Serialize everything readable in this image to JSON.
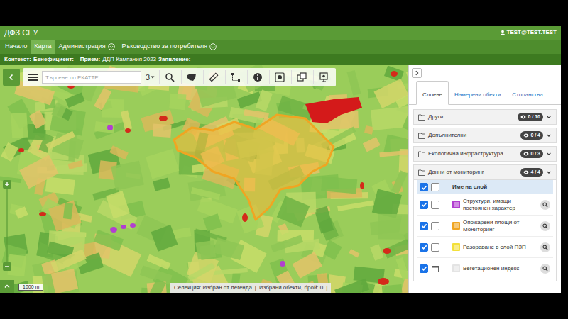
{
  "header": {
    "title": "ДФЗ СЕУ",
    "user": "TEST@TEST.TEST"
  },
  "nav": [
    {
      "label": "Начало",
      "selected": false,
      "dropdown": false
    },
    {
      "label": "Карта",
      "selected": true,
      "dropdown": false
    },
    {
      "label": "Администрация",
      "selected": false,
      "dropdown": true
    },
    {
      "label": "Ръководство за потребителя",
      "selected": false,
      "dropdown": true
    }
  ],
  "context": {
    "label": "Контекст:",
    "items": [
      {
        "label": "Бенефициент:",
        "value": "-"
      },
      {
        "label": "Прием:",
        "value": "ДДП-Кампания 2023"
      },
      {
        "label": "Заявление:",
        "value": "-"
      }
    ]
  },
  "toolbar": {
    "search_placeholder": "Търсене по ЕКАТТЕ",
    "zoom_level": "3"
  },
  "map": {
    "scale": "1000 m",
    "status": [
      {
        "text": "Селекция: Избран от легенда"
      },
      {
        "text": "Избрани обекти, брой: 0"
      }
    ],
    "separator": "|"
  },
  "panel": {
    "tabs": [
      {
        "label": "Слоеве",
        "selected": true
      },
      {
        "label": "Намерени обекти",
        "selected": false
      },
      {
        "label": "Стопанства",
        "selected": false
      }
    ],
    "groups": [
      {
        "label": "Други",
        "badge": "0 / 10",
        "expanded": false
      },
      {
        "label": "Допълнителни",
        "badge": "0 / 4",
        "expanded": false
      },
      {
        "label": "Екологична инфраструктура",
        "badge": "0 / 3",
        "expanded": false
      },
      {
        "label": "Данни от мониторинг",
        "badge": "4 / 4",
        "expanded": true
      }
    ],
    "layers": {
      "header": "Име на слой",
      "all_visible": true,
      "all_selected": false,
      "rows": [
        {
          "name": "Структури, имащи постоянен характер",
          "visible": true,
          "kind": "checkbox",
          "selected": false,
          "color": "#b23fd0"
        },
        {
          "name": "Опожарени площи от Мониторинг",
          "visible": true,
          "kind": "checkbox",
          "selected": false,
          "color": "#f0a522"
        },
        {
          "name": "Разораване в слой ПЗП",
          "visible": true,
          "kind": "checkbox",
          "selected": false,
          "color": "#f3e03a"
        },
        {
          "name": "Вегетационен индекс",
          "visible": true,
          "kind": "calendar",
          "color": "#e4e4e4"
        }
      ]
    }
  }
}
